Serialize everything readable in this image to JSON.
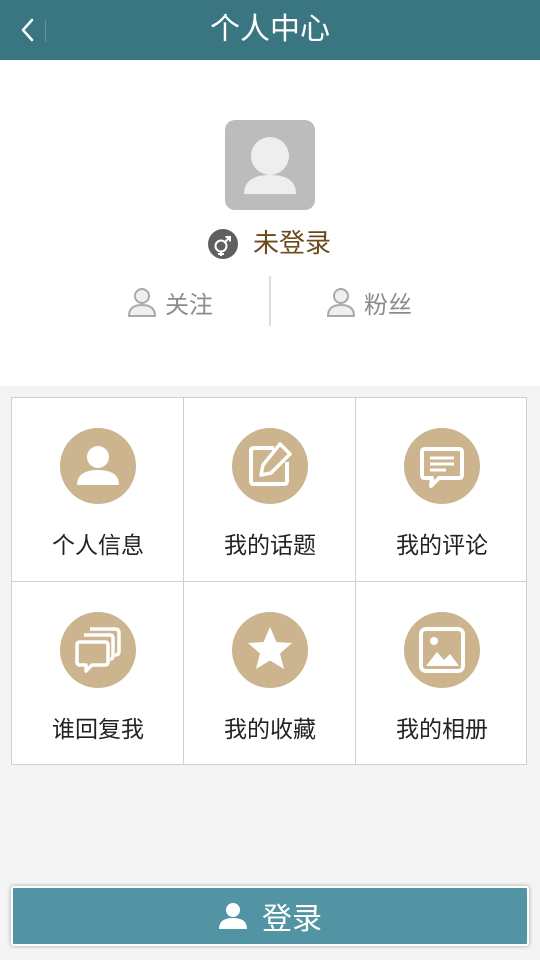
{
  "header": {
    "title": "个人中心",
    "back_icon": "chevron-left-icon"
  },
  "profile": {
    "avatar_icon": "default-avatar-icon",
    "gender_icon": "gender-icon",
    "username": "未登录",
    "stats": [
      {
        "label": "关注",
        "icon": "user-outline-icon"
      },
      {
        "label": "粉丝",
        "icon": "user-outline-icon"
      }
    ]
  },
  "menu": {
    "items": [
      {
        "label": "个人信息",
        "icon": "user-icon"
      },
      {
        "label": "我的话题",
        "icon": "edit-icon"
      },
      {
        "label": "我的评论",
        "icon": "comment-icon"
      },
      {
        "label": "谁回复我",
        "icon": "chat-icon"
      },
      {
        "label": "我的收藏",
        "icon": "star-icon"
      },
      {
        "label": "我的相册",
        "icon": "image-icon"
      }
    ]
  },
  "login": {
    "label": "登录",
    "icon": "user-icon"
  },
  "colors": {
    "header_bg": "#3a7682",
    "menu_icon_bg": "#cbb48e",
    "username_text": "#6b4a1e",
    "login_bg": "#5294a3"
  }
}
